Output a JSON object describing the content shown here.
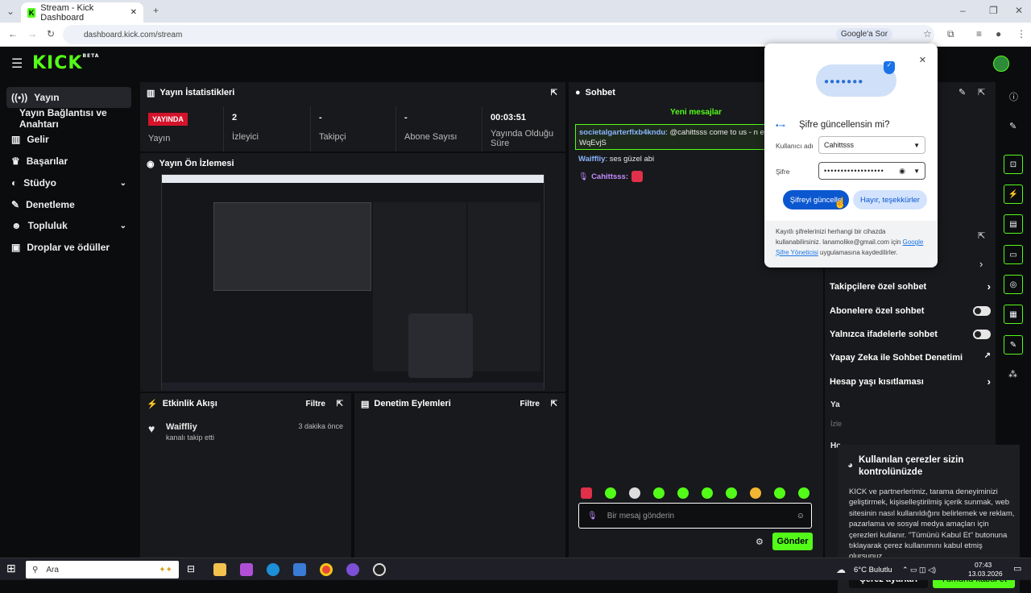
{
  "browser": {
    "tab_title": "Stream - Kick Dashboard",
    "url": "dashboard.kick.com/stream",
    "google_btn": "Google'a Sor"
  },
  "logo": {
    "text": "KICK",
    "tag": "BETA"
  },
  "sidebar": {
    "items": [
      {
        "label": "Yayın",
        "icon": "broadcast-icon"
      },
      {
        "label": "Yayın Bağlantısı ve Anahtarı"
      },
      {
        "label": "Gelir",
        "icon": "chart-icon"
      },
      {
        "label": "Başarılar",
        "icon": "trophy-icon"
      },
      {
        "label": "Stüdyo",
        "icon": "palette-icon"
      },
      {
        "label": "Denetleme",
        "icon": "wrench-icon"
      },
      {
        "label": "Topluluk",
        "icon": "people-icon"
      },
      {
        "label": "Droplar ve ödüller",
        "icon": "gift-icon"
      }
    ]
  },
  "stats": {
    "title": "Yayın İstatistikleri",
    "live_badge": "YAYINDA",
    "items": [
      {
        "value": "",
        "label": "Yayın"
      },
      {
        "value": "2",
        "label": "İzleyici"
      },
      {
        "value": "-",
        "label": "Takipçi"
      },
      {
        "value": "-",
        "label": "Abone Sayısı"
      },
      {
        "value": "00:03:51",
        "label": "Yayında Olduğu Süre"
      }
    ]
  },
  "preview": {
    "title": "Yayın Ön İzlemesi"
  },
  "activity": {
    "title": "Etkinlik Akışı",
    "filter": "Filtre",
    "event_user": "Waiffliy",
    "event_text": "kanalı takip etti",
    "event_time": "3 dakika önce"
  },
  "mod_actions": {
    "title": "Denetim Eylemleri",
    "filter": "Filtre"
  },
  "chat": {
    "title": "Sohbet",
    "new_messages": "Yeni mesajlar",
    "messages": [
      {
        "user": "societalgarterflxb4kndu",
        "text": ": @cahittsss come to us - n e z",
        "cont": "WqEvjS"
      },
      {
        "user": "Waiffliy",
        "text": ": ses güzel abi"
      },
      {
        "user": "Cahittsss:",
        "text": ""
      }
    ],
    "input_placeholder": "Bir mesaj gönderin",
    "send": "Gönder"
  },
  "chat_settings": {
    "rows": [
      {
        "label": "Takipçilere özel sohbet",
        "type": "arrow"
      },
      {
        "label": "Abonelere özel sohbet",
        "type": "toggle"
      },
      {
        "label": "Yalnızca ifadelerle sohbet",
        "type": "toggle"
      },
      {
        "label": "Yapay Zeka ile Sohbet Denetimi",
        "type": "external"
      },
      {
        "label": "Hesap yaşı kısıtlaması",
        "type": "arrow"
      }
    ],
    "partial": [
      "Ya",
      "İzle",
      "He"
    ]
  },
  "password_popup": {
    "title": "Şifre güncellensin mi?",
    "username_label": "Kullanıcı adı",
    "username_value": "Cahittsss",
    "password_label": "Şifre",
    "password_value": "••••••••••••••••••",
    "update_btn": "Şifreyi güncelle",
    "no_btn": "Hayır, teşekkürler",
    "footer": "Kayıtlı şifrelerinizi herhangi bir cihazda kullanabilirsiniz. lanamolike@gmail.com için",
    "link": "Google Şifre Yöneticisi",
    "footer2": "uygulamasına kaydedilirler."
  },
  "cookie": {
    "title": "Kullanılan çerezler sizin kontrolünüzde",
    "body": "KICK ve partnerlerimiz, tarama deneyiminizi geliştirmek, kişiselleştirilmiş içerik sunmak, web sitesinin nasıl kullanıldığını belirlemek ve reklam, pazarlama ve sosyal medya amaçları için çerezleri kullanır. \"Tümünü Kabul Et\" butonuna tıklayarak çerez kullanımını kabul etmiş olursunuz.",
    "settings_btn": "Çerez ayarları",
    "accept_btn": "Tümünü kabul et"
  },
  "taskbar": {
    "search": "Ara",
    "weather": "6°C Bulutlu",
    "time": "07:43",
    "date": "13.03.2026"
  },
  "colors": {
    "accent": "#53fc18",
    "live": "#d4132b",
    "panel": "#18191c"
  }
}
